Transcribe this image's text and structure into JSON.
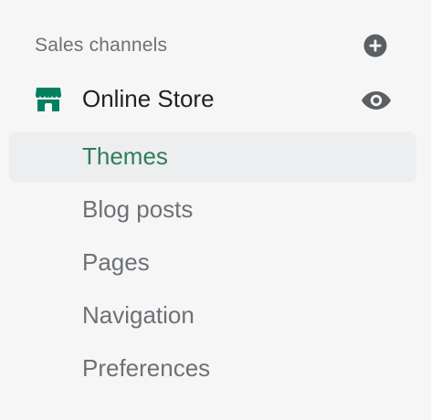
{
  "sales_channels": {
    "title": "Sales channels",
    "add_icon": "plus-circle-icon"
  },
  "online_store": {
    "label": "Online Store",
    "store_icon": "storefront-icon",
    "view_icon": "eye-icon",
    "brand_color": "#008060"
  },
  "sub_items": [
    {
      "label": "Themes",
      "active": true
    },
    {
      "label": "Blog posts",
      "active": false
    },
    {
      "label": "Pages",
      "active": false
    },
    {
      "label": "Navigation",
      "active": false
    },
    {
      "label": "Preferences",
      "active": false
    }
  ]
}
